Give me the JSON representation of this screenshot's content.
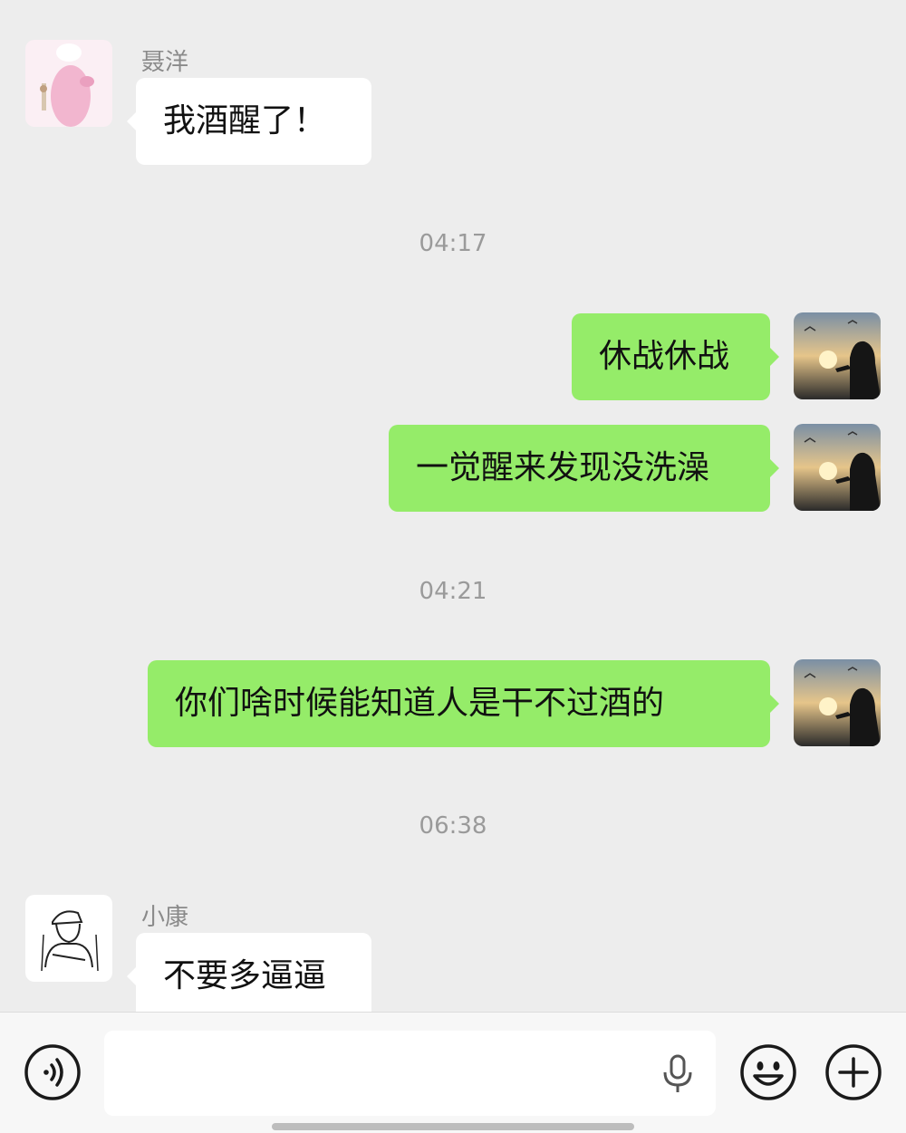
{
  "messages": [
    {
      "side": "in",
      "sender": "聂洋",
      "text": "我酒醒了！"
    },
    {
      "timestamp": "04:17"
    },
    {
      "side": "out",
      "text": "休战休战"
    },
    {
      "side": "out",
      "text": "一觉醒来发现没洗澡"
    },
    {
      "timestamp": "04:21"
    },
    {
      "side": "out",
      "text": "你们啥时候能知道人是干不过酒的"
    },
    {
      "timestamp": "06:38"
    },
    {
      "side": "in",
      "sender": "小康",
      "text": "不要多逼逼"
    }
  ],
  "input": {
    "value": ""
  },
  "icons": {
    "voice": "voice-mode-icon",
    "mic": "microphone-icon",
    "emoji": "emoji-icon",
    "more": "plus-icon"
  },
  "colors": {
    "background": "#ededed",
    "outgoing_bubble": "#95ec69",
    "incoming_bubble": "#ffffff"
  }
}
